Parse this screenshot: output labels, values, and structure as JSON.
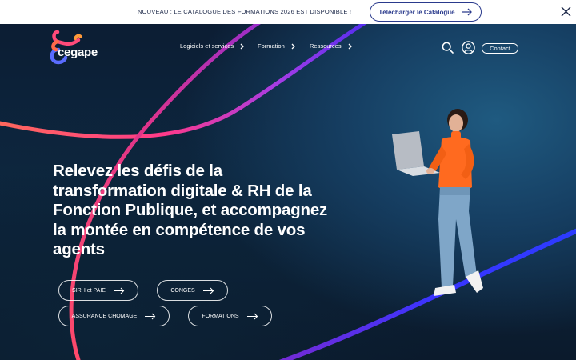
{
  "announcement": {
    "text": "NOUVEAU : LE CATALOGUE DES FORMATIONS 2026 EST DISPONIBLE !",
    "cta_label": "Télécharger le Catalogue"
  },
  "brand": {
    "name": "cegape"
  },
  "nav": {
    "items": [
      {
        "label": "Logiciels et services"
      },
      {
        "label": "Formation"
      },
      {
        "label": "Ressources"
      }
    ],
    "contact_label": "Contact"
  },
  "hero": {
    "title_lines": [
      "Relevez les défis de la",
      "transformation digitale & RH de la",
      "Fonction Publique, et accompagnez",
      "la montée en compétence de vos",
      "agents"
    ],
    "buttons": [
      {
        "label": "SIRH et PAIE"
      },
      {
        "label": "CONGES"
      },
      {
        "label": "ASSURANCE CHOMAGE"
      },
      {
        "label": "FORMATIONS"
      }
    ]
  },
  "colors": {
    "accent_navy": "#2a3a8c",
    "curve_pink": "#ff5a6e",
    "curve_purple": "#7a3cf0",
    "curve_blue": "#2f3cff",
    "logo_orange": "#ff8a3c"
  }
}
